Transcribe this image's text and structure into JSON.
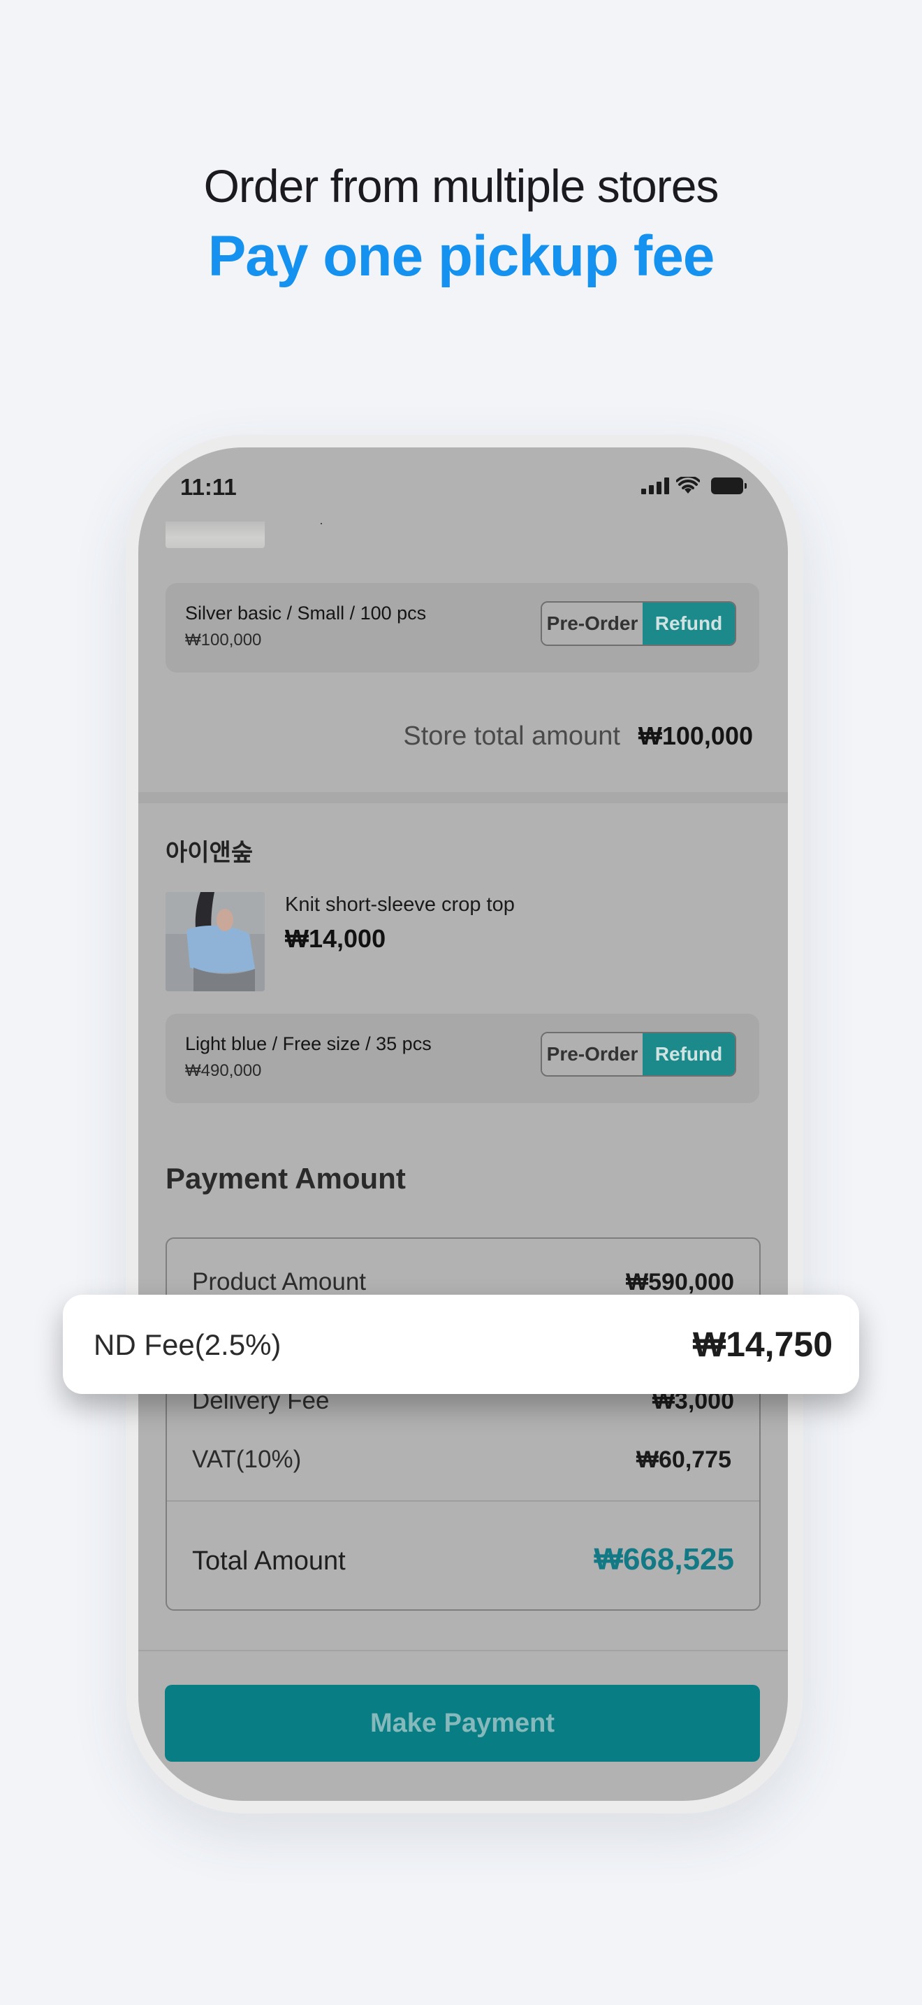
{
  "promo": {
    "headline": "Order from multiple stores",
    "headline_accent": "Pay one pickup fee",
    "accent_color": "#1591ef"
  },
  "status_bar": {
    "time": "11:11",
    "icons": [
      "signal-icon",
      "wifi-icon",
      "battery-icon"
    ]
  },
  "store_1": {
    "option": {
      "title": "Silver basic / Small / 100 pcs",
      "price": "₩100,000",
      "preorder_label": "Pre-Order",
      "refund_label": "Refund"
    },
    "total_label": "Store total amount",
    "total_value": "₩100,000"
  },
  "store_2": {
    "name": "아이앤숲",
    "product": {
      "name": "Knit short-sleeve crop top",
      "price": "₩14,000"
    },
    "option": {
      "title": "Light blue / Free size / 35 pcs",
      "price": "₩490,000",
      "preorder_label": "Pre-Order",
      "refund_label": "Refund"
    }
  },
  "payment": {
    "section_title": "Payment Amount",
    "rows": [
      {
        "label": "Product Amount",
        "value": "₩590,000"
      },
      {
        "label": "Delivery Fee",
        "value": "₩3,000"
      },
      {
        "label": "VAT(10%)",
        "value": "₩60,775"
      }
    ],
    "total_label": "Total Amount",
    "total_value": "₩668,525",
    "total_color": "#137a85"
  },
  "fee_highlight": {
    "label": "ND Fee(2.5%)",
    "value": "₩14,750"
  },
  "cta": {
    "label": "Make Payment",
    "color": "#087d83"
  }
}
